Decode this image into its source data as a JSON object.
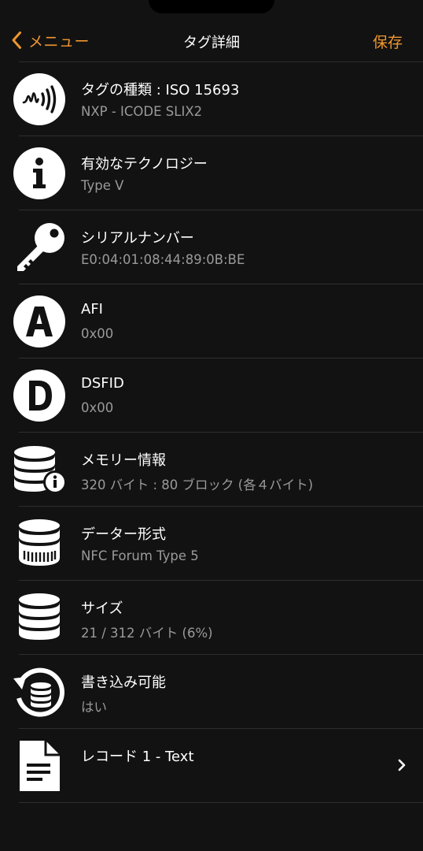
{
  "nav": {
    "back_label": "メニュー",
    "title": "タグ詳細",
    "save_label": "保存"
  },
  "accent_color": "#f0962e",
  "rows": [
    {
      "icon": "nfc-wave-icon",
      "title": "タグの種類 : ISO 15693",
      "sub": "NXP - ICODE SLIX2"
    },
    {
      "icon": "info-icon",
      "title": "有効なテクノロジー",
      "sub": "Type V"
    },
    {
      "icon": "key-icon",
      "title": "シリアルナンバー",
      "sub": "E0:04:01:08:44:89:0B:BE"
    },
    {
      "icon": "letter-a-icon",
      "title": "AFI",
      "sub": "0x00"
    },
    {
      "icon": "letter-d-icon",
      "title": "DSFID",
      "sub": "0x00"
    },
    {
      "icon": "database-info-icon",
      "title": "メモリー情報",
      "sub": "320 バイト : 80 ブロック (各４バイト)"
    },
    {
      "icon": "database-format-icon",
      "title": "データー形式",
      "sub": "NFC Forum Type 5"
    },
    {
      "icon": "database-icon",
      "title": "サイズ",
      "sub": "21 / 312 バイト (6%)"
    },
    {
      "icon": "database-rewrite-icon",
      "title": "書き込み可能",
      "sub": "はい"
    },
    {
      "icon": "document-icon",
      "title": "レコード 1 - Text"
    }
  ]
}
